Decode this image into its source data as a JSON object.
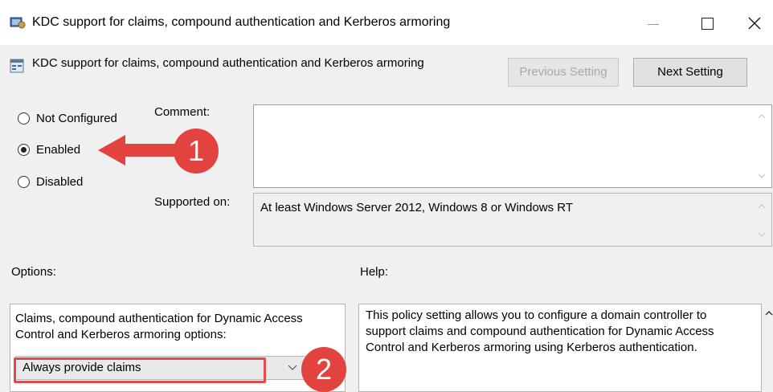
{
  "window": {
    "title": "KDC support for claims, compound authentication and Kerberos armoring",
    "minimize_label": "—",
    "maximize_label": "☐",
    "close_label": "✕"
  },
  "header": {
    "policy_title": "KDC support for claims, compound authentication and Kerberos armoring",
    "previous_setting_label": "Previous Setting",
    "next_setting_label": "Next Setting"
  },
  "state": {
    "options": [
      {
        "label": "Not Configured",
        "checked": false
      },
      {
        "label": "Enabled",
        "checked": true
      },
      {
        "label": "Disabled",
        "checked": false
      }
    ]
  },
  "comment": {
    "label": "Comment:",
    "value": ""
  },
  "supported_on": {
    "label": "Supported on:",
    "value": "At least Windows Server 2012, Windows 8 or Windows RT"
  },
  "options_section": {
    "label": "Options:",
    "description": "Claims, compound authentication for Dynamic Access Control and Kerberos armoring options:",
    "selected_value": "Always provide claims"
  },
  "help_section": {
    "label": "Help:",
    "text": "This policy setting allows you to configure a domain controller to support claims and compound authentication for Dynamic Access Control and Kerberos armoring using Kerberos authentication."
  },
  "annotations": {
    "step1": "1",
    "step2": "2",
    "accent_color": "#e2433f"
  }
}
